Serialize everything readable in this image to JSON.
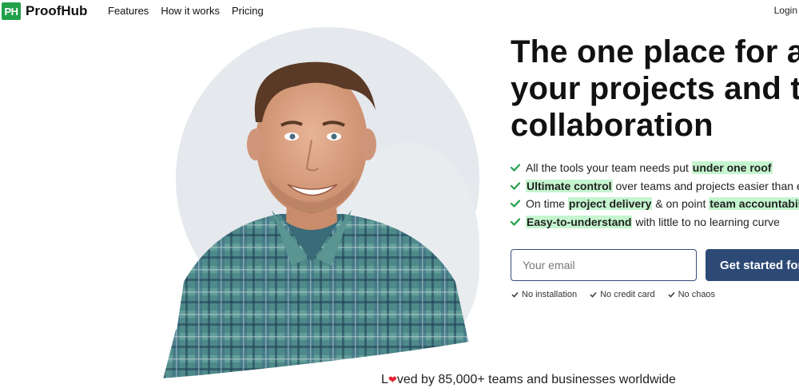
{
  "brand": {
    "logo_mark": "PH",
    "name": "ProofHub",
    "color": "#22a04a"
  },
  "nav": {
    "items": [
      "Features",
      "How it works",
      "Pricing"
    ],
    "login": "Login"
  },
  "hero": {
    "headline_lines": [
      "The one place for al",
      "your projects and te",
      "collaboration"
    ],
    "features": [
      {
        "before": "All the tools your team needs put ",
        "highlight": "under one roof",
        "after": ""
      },
      {
        "before": "",
        "highlight": "Ultimate control",
        "after": " over teams and projects easier than eve"
      },
      {
        "before": "On time ",
        "highlight": "project delivery",
        "after": " & on point ",
        "highlight2": "team accountability"
      },
      {
        "before": "",
        "highlight": "Easy-to-understand",
        "after": " with little to no learning curve"
      }
    ],
    "email_placeholder": "Your email",
    "cta_label": "Get started for",
    "perks": [
      "No installation",
      "No credit card",
      "No chaos"
    ]
  },
  "social_proof": {
    "prefix": "L",
    "suffix": "ved by 85,000+ teams and businesses worldwide",
    "heart_icon": "heart-icon"
  },
  "colors": {
    "accent": "#2d4a77",
    "check": "#22a04a",
    "highlight": "#c5f5cf",
    "heart": "#e02030"
  }
}
